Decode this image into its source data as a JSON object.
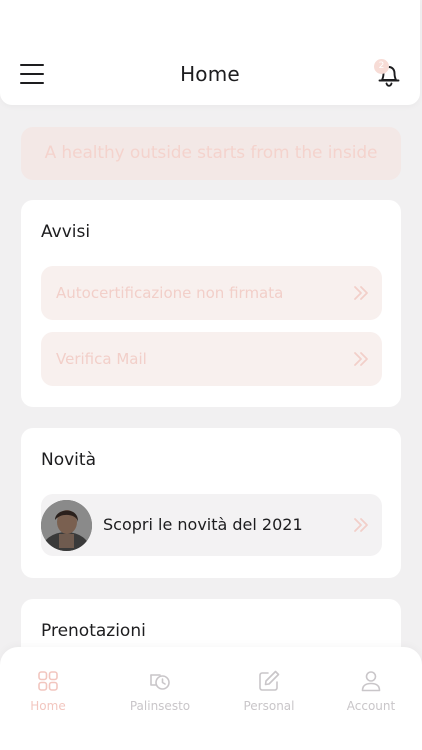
{
  "header": {
    "title": "Home",
    "menu_icon": "hamburger-menu-icon",
    "notification_icon": "bell-icon",
    "notification_count": "2"
  },
  "motto": "A healthy outside starts from the inside",
  "avvisi": {
    "title": "Avvisi",
    "items": [
      {
        "label": "Autocertificazione non firmata",
        "icon": "double-chevron-right-icon"
      },
      {
        "label": "Verifica Mail",
        "icon": "double-chevron-right-icon"
      }
    ]
  },
  "novita": {
    "title": "Novità",
    "item": {
      "label": "Scopri le novità del 2021",
      "icon": "double-chevron-right-icon"
    }
  },
  "prenotazioni": {
    "title": "Prenotazioni"
  },
  "bottom_nav": {
    "active": "Home",
    "items": [
      {
        "label": "Home",
        "icon": "grid-icon"
      },
      {
        "label": "Palinsesto",
        "icon": "schedule-icon"
      },
      {
        "label": "Personal",
        "icon": "edit-icon"
      },
      {
        "label": "Account",
        "icon": "user-icon"
      }
    ]
  },
  "colors": {
    "accent": "#f2c6bf",
    "accent_light": "#f8f0ee",
    "text": "#1d1d1f",
    "background": "#f1f0f1"
  }
}
